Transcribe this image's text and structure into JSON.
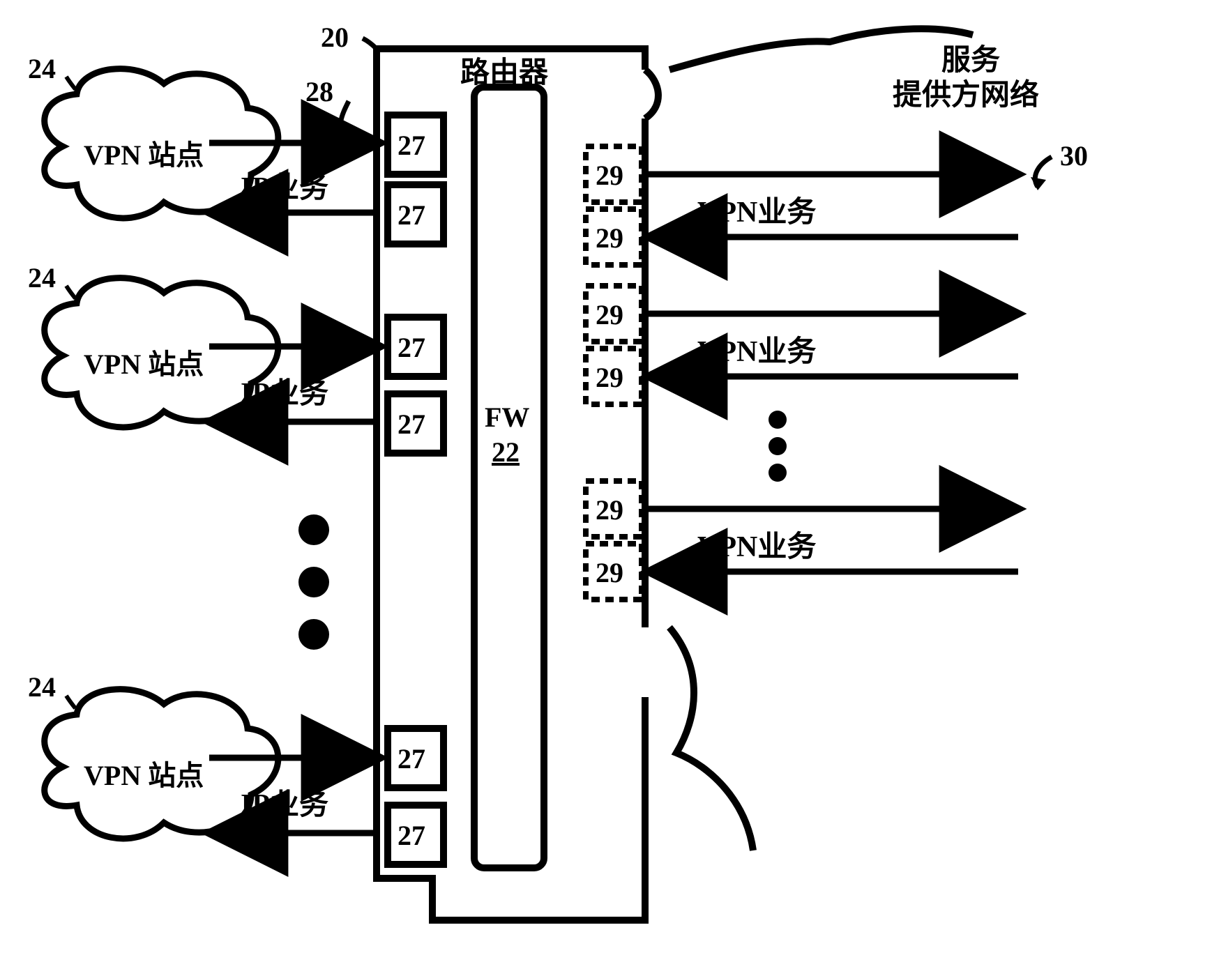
{
  "router": {
    "title": "路由器",
    "num": "20",
    "fw_label": "FW",
    "fw_num": "22"
  },
  "left": {
    "port_label": "27",
    "group_num": "28",
    "traffic_label": "IP业务",
    "sites": [
      {
        "num": "24",
        "label": "VPN 站点"
      },
      {
        "num": "24",
        "label": "VPN 站点"
      },
      {
        "num": "24",
        "label": "VPN 站点"
      }
    ]
  },
  "right": {
    "port_label": "29",
    "group_num": "30",
    "traffic_label": "VPN业务",
    "provider_label_line1": "服务",
    "provider_label_line2": "提供方网络"
  }
}
